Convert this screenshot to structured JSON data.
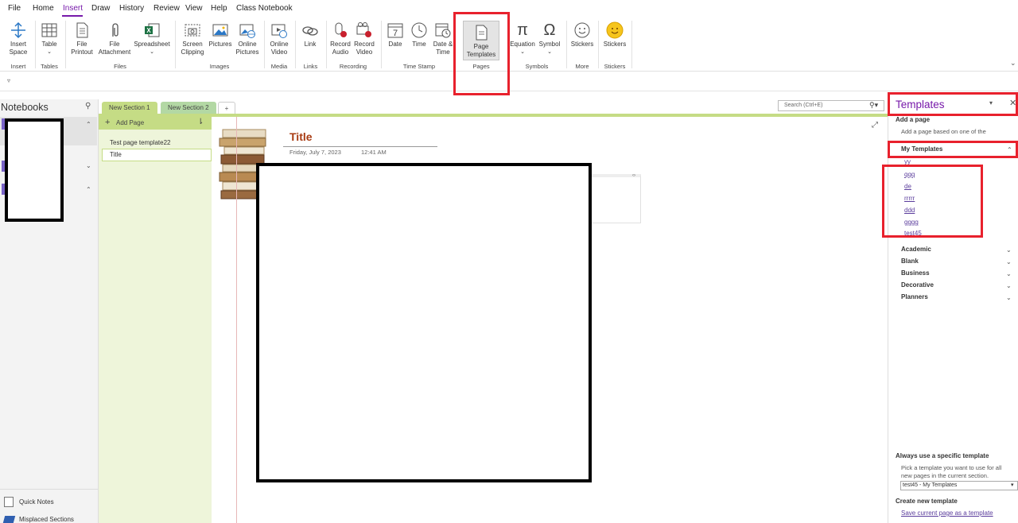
{
  "menu": {
    "items": [
      "File",
      "Home",
      "Insert",
      "Draw",
      "History",
      "Review",
      "View",
      "Help",
      "Class Notebook"
    ],
    "active": "Insert"
  },
  "ribbon": {
    "insert_space": "Insert\nSpace",
    "table": "Table",
    "file_printout": "File\nPrintout",
    "file_attachment": "File\nAttachment",
    "spreadsheet": "Spreadsheet",
    "screen_clipping": "Screen\nClipping",
    "pictures": "Pictures",
    "online_pictures": "Online\nPictures",
    "online_video": "Online\nVideo",
    "link": "Link",
    "record_audio": "Record\nAudio",
    "record_video": "Record\nVideo",
    "date": "Date",
    "date_number": "7",
    "time": "Time",
    "date_time": "Date &\nTime",
    "page_templates": "Page\nTemplates",
    "equation": "Equation",
    "symbol": "Symbol",
    "stickers_more": "Stickers",
    "stickers": "Stickers",
    "groups": {
      "insert": "Insert",
      "tables": "Tables",
      "files": "Files",
      "images": "Images",
      "media": "Media",
      "links": "Links",
      "recording": "Recording",
      "time_stamp": "Time Stamp",
      "pages": "Pages",
      "symbols": "Symbols",
      "more": "More",
      "stickers": "Stickers"
    }
  },
  "notebooks": {
    "title": "Notebooks",
    "quick_notes": "Quick Notes",
    "misplaced_sections": "Misplaced Sections"
  },
  "sections": {
    "tab1": "New Section 1",
    "tab2": "New Section 2",
    "add_tab": "+"
  },
  "search": {
    "placeholder": "Search (Ctrl+E)"
  },
  "pages": {
    "add_page": "Add Page",
    "items": [
      "Test page template22",
      "Title"
    ]
  },
  "page": {
    "title": "Title",
    "date": "Friday, July 7, 2023",
    "time": "12:41 AM"
  },
  "templates_pane": {
    "title": "Templates",
    "add_a_page": "Add a page",
    "add_desc": "Add a page based on one of the",
    "my_templates": "My Templates",
    "my_items": [
      "yy",
      "qqq",
      "de",
      "rrrrr",
      "ddd",
      "gggg",
      "test45"
    ],
    "categories": [
      "Academic",
      "Blank",
      "Business",
      "Decorative",
      "Planners"
    ],
    "always_use": "Always use a specific template",
    "always_desc": "Pick a template you want to use for all new pages in the current section.",
    "select_value": "test45 - My Templates",
    "create_new": "Create new template",
    "save_link": "Save current page as a template"
  },
  "colors": {
    "accent": "#7719aa",
    "highlight": "#e8212d",
    "section_green": "#c5dc85",
    "page_list_bg": "#eef5da",
    "title_color": "#a83b12"
  }
}
